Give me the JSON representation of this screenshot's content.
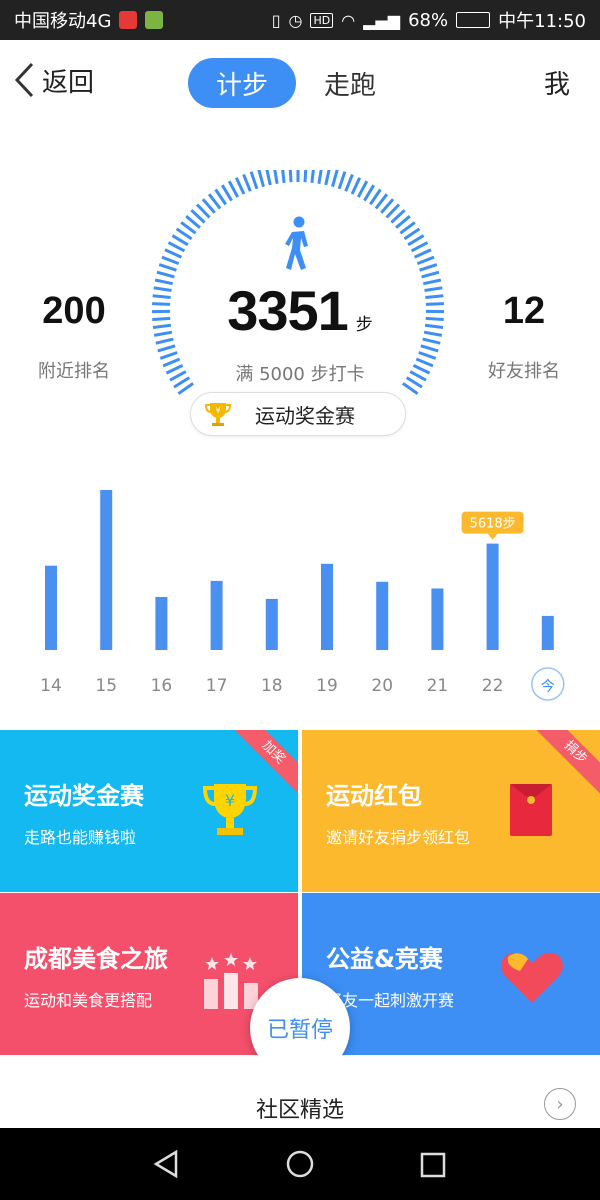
{
  "status_bar": {
    "carrier": "中国移动4G",
    "battery": "68%",
    "time": "中午11:50",
    "icons": [
      "vibrate-icon",
      "alarm-icon",
      "hd-icon",
      "wifi-icon",
      "signal-icon",
      "battery-icon"
    ]
  },
  "nav": {
    "back_label": "返回",
    "tabs": [
      {
        "label": "计步",
        "active": true
      },
      {
        "label": "走跑",
        "active": false
      }
    ],
    "me_label": "我"
  },
  "gauge": {
    "steps": "3351",
    "unit": "步",
    "goal_text": "满 5000 步打卡",
    "progress": 0.67,
    "nearby_rank": "200",
    "nearby_label": "附近排名",
    "friend_rank": "12",
    "friend_label": "好友排名",
    "contest_label": "运动奖金赛",
    "accent": "#3d8ef5"
  },
  "chart_data": {
    "type": "bar",
    "categories": [
      "14",
      "15",
      "16",
      "17",
      "18",
      "19",
      "20",
      "21",
      "22",
      "今"
    ],
    "values": [
      4450,
      8450,
      2800,
      3650,
      2700,
      4550,
      3600,
      3250,
      5618,
      1800
    ],
    "selected_index": 8,
    "tooltip": "5618步",
    "today_index": 9,
    "color": "#4a90f0",
    "tooltip_color": "#fdb92e"
  },
  "tiles": [
    {
      "title": "运动奖金赛",
      "subtitle": "走路也能赚钱啦",
      "ribbon": "加奖",
      "color": "#13b9f0",
      "icon": "trophy-icon"
    },
    {
      "title": "运动红包",
      "subtitle": "邀请好友捐步领红包",
      "ribbon": "捐步",
      "color": "#fdb92e",
      "icon": "red-envelope-icon"
    },
    {
      "title": "成都美食之旅",
      "subtitle": "运动和美食更搭配",
      "ribbon": "",
      "color": "#f5506b",
      "icon": "podium-icon"
    },
    {
      "title": "公益&竞赛",
      "subtitle": "好友一起刺激开赛",
      "ribbon": "",
      "color": "#3d8ef5",
      "icon": "heart-icon"
    }
  ],
  "paused_label": "已暂停",
  "community": {
    "title": "社区精选"
  }
}
